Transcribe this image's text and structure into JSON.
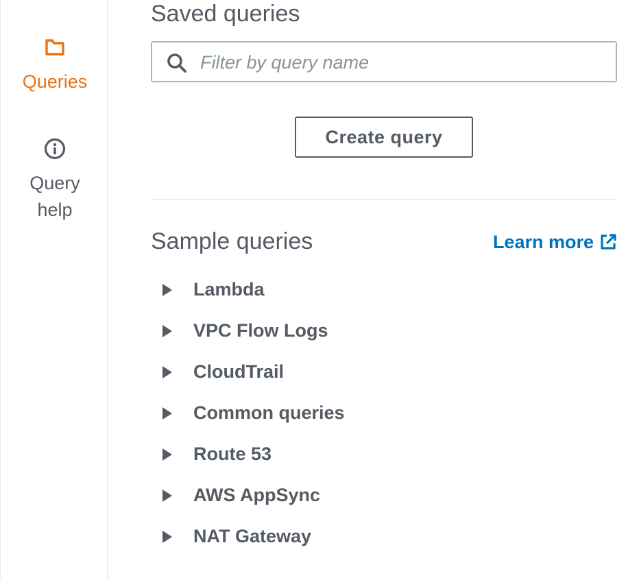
{
  "nav": {
    "items": [
      {
        "label": "Queries",
        "icon": "folder-icon",
        "active": true
      },
      {
        "label": "Query\nhelp",
        "icon": "info-icon",
        "active": false
      }
    ]
  },
  "saved": {
    "title": "Saved queries",
    "search_placeholder": "Filter by query name",
    "search_value": "",
    "create_label": "Create query"
  },
  "samples": {
    "title": "Sample queries",
    "learn_more_label": "Learn more",
    "items": [
      {
        "label": "Lambda"
      },
      {
        "label": "VPC Flow Logs"
      },
      {
        "label": "CloudTrail"
      },
      {
        "label": "Common queries"
      },
      {
        "label": "Route 53"
      },
      {
        "label": "AWS AppSync"
      },
      {
        "label": "NAT Gateway"
      }
    ]
  },
  "colors": {
    "accent": "#ec7211",
    "link": "#0073bb",
    "text": "#545b64",
    "border": "#aab7b8",
    "divider": "#eaeded"
  }
}
